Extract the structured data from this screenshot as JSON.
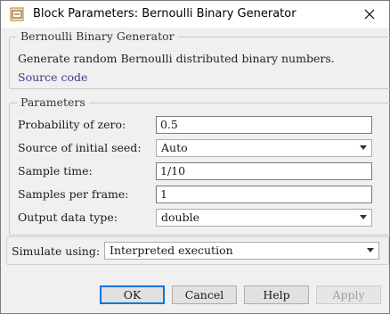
{
  "window": {
    "title": "Block Parameters: Bernoulli Binary Generator"
  },
  "block": {
    "name": "Bernoulli Binary Generator",
    "description": "Generate random Bernoulli distributed binary numbers.",
    "source_link": "Source code"
  },
  "parameters": {
    "legend": "Parameters",
    "probability_zero": {
      "label": "Probability of zero:",
      "value": "0.5"
    },
    "initial_seed": {
      "label": "Source of initial seed:",
      "value": "Auto"
    },
    "sample_time": {
      "label": "Sample time:",
      "value": "1/10"
    },
    "samples_per_frame": {
      "label": "Samples per frame:",
      "value": "1"
    },
    "output_type": {
      "label": "Output data type:",
      "value": "double"
    }
  },
  "simulate": {
    "label": "Simulate using:",
    "value": "Interpreted execution"
  },
  "buttons": {
    "ok": "OK",
    "cancel": "Cancel",
    "help": "Help",
    "apply": "Apply"
  },
  "icons": {
    "app": "simulink-block-icon",
    "close": "close-icon",
    "dropdown": "chevron-down-icon"
  }
}
